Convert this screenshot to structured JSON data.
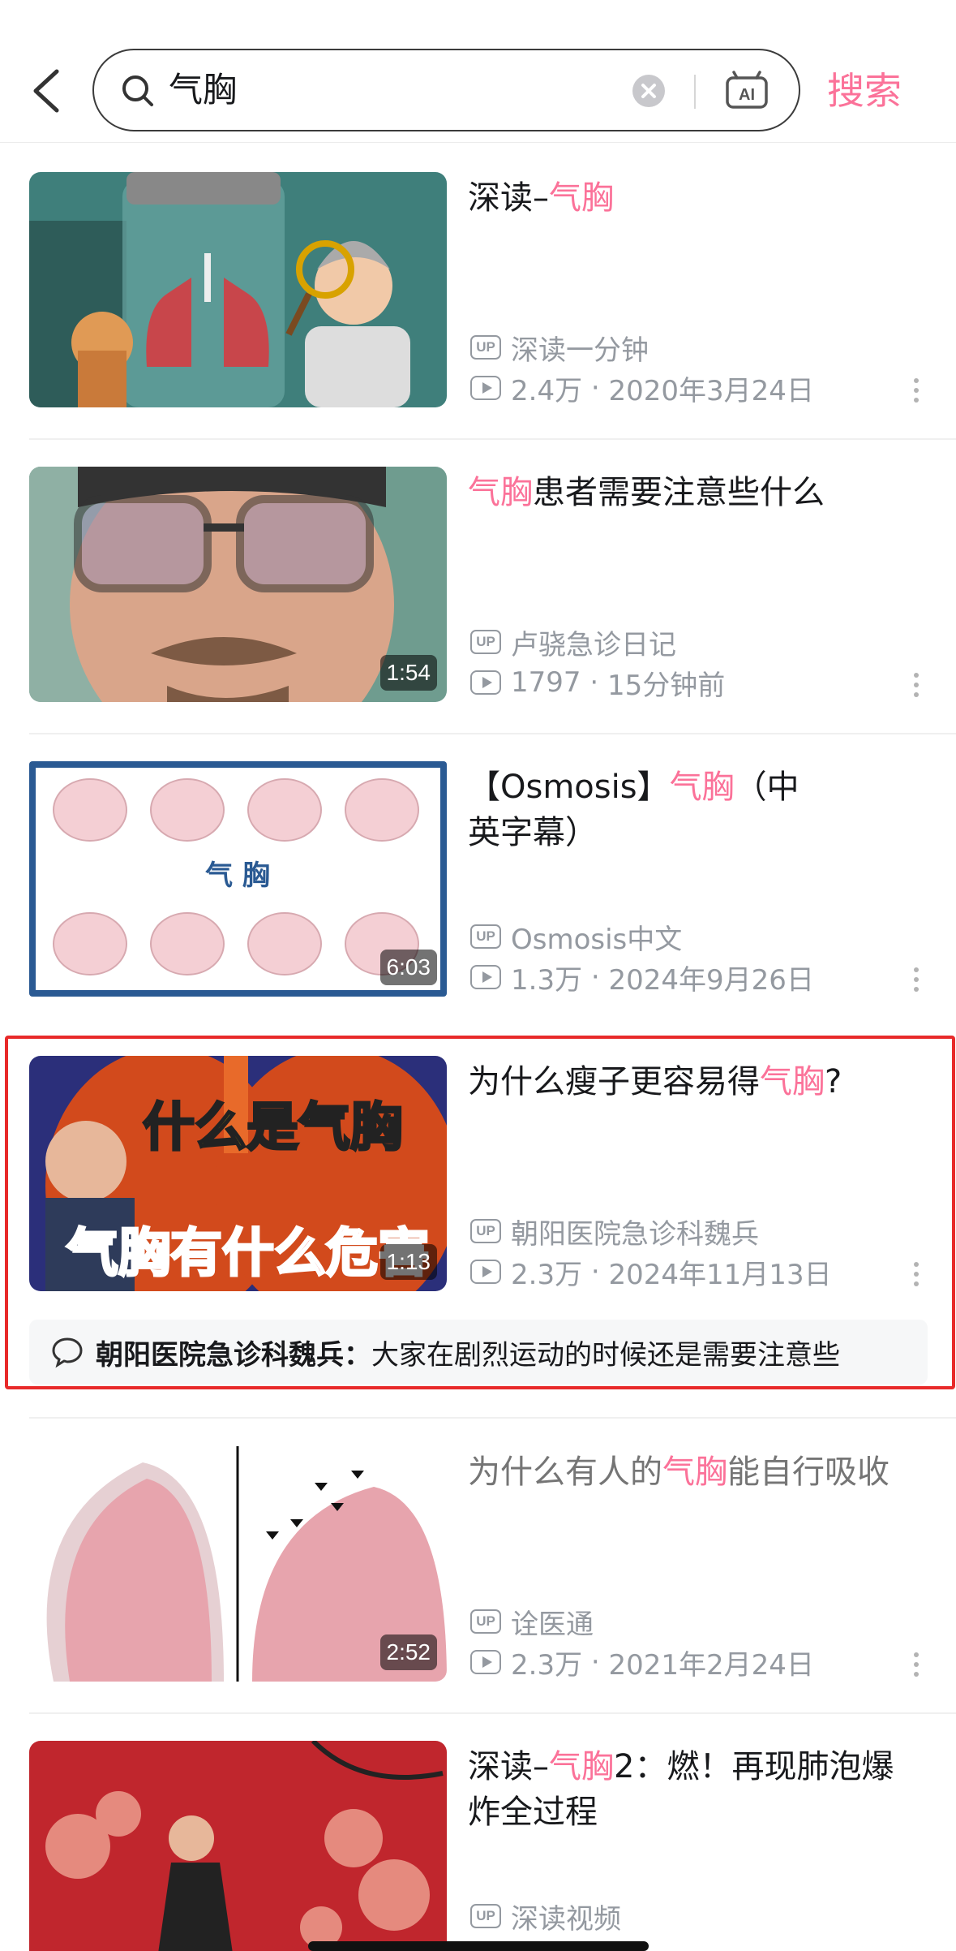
{
  "search": {
    "query": "气胸",
    "button_label": "搜索",
    "ai_label": "AI"
  },
  "results": [
    {
      "title_pre": "深读–",
      "title_hl": "气胸",
      "title_post": "",
      "uploader": "深读一分钟",
      "views": "2.4万",
      "date": "2020年3月24日",
      "duration": ""
    },
    {
      "title_pre": "",
      "title_hl": "气胸",
      "title_post": "患者需要注意些什么",
      "uploader": "卢骁急诊日记",
      "views": "1797",
      "date": "15分钟前",
      "duration": "1:54"
    },
    {
      "title_pre": "【Osmosis】",
      "title_hl": "气胸",
      "title_post": "（中英字幕）",
      "uploader": "Osmosis中文",
      "views": "1.3万",
      "date": "2024年9月26日",
      "duration": "6:03",
      "thumb_text": "气  胸"
    },
    {
      "title_pre": "为什么瘦子更容易得",
      "title_hl": "气胸",
      "title_post": "?",
      "uploader": "朝阳医院急诊科魏兵",
      "views": "2.3万",
      "date": "2024年11月13日",
      "duration": "1:13",
      "thumb_text_top": "什么是气胸",
      "thumb_text_bottom": "气胸有什么危害",
      "comment_author": "朝阳医院急诊科魏兵：",
      "comment_text": "大家在剧烈运动的时候还是需要注意些"
    },
    {
      "title_pre": "为什么有人的",
      "title_hl": "气胸",
      "title_post": "能自行吸收",
      "uploader": "诠医通",
      "views": "2.3万",
      "date": "2021年2月24日",
      "duration": "2:52"
    },
    {
      "title_pre": "深读–",
      "title_hl": "气胸",
      "title_post": "2：燃！再现肺泡爆炸全过程",
      "uploader": "深读视频",
      "views": "",
      "date": "",
      "duration": ""
    }
  ],
  "colors": {
    "accent": "#fb7299",
    "highlight_border": "#e82a2a",
    "meta_gray": "#9499a0"
  }
}
